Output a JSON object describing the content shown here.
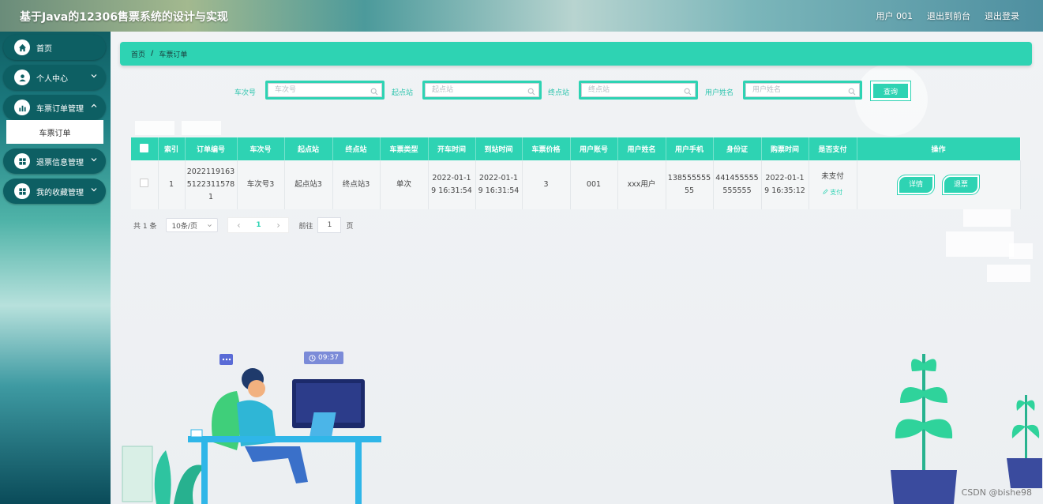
{
  "header": {
    "site_title": "基于Java的12306售票系统的设计与实现",
    "links": [
      "用户 001",
      "退出到前台",
      "退出登录"
    ]
  },
  "sidebar": {
    "items": [
      {
        "label": "首页",
        "icon": "home-icon"
      },
      {
        "label": "个人中心",
        "icon": "user-icon"
      },
      {
        "label": "车票订单管理",
        "icon": "bar-chart-icon"
      },
      {
        "label": "退票信息管理",
        "icon": "grid-icon"
      },
      {
        "label": "我的收藏管理",
        "icon": "grid-icon"
      }
    ],
    "sub_item": "车票订单"
  },
  "breadcrumb": {
    "home": "首页",
    "separator": "/",
    "current": "车票订单"
  },
  "search": {
    "train_label": "车次号",
    "train_placeholder": "车次号",
    "from_label": "起点站",
    "from_placeholder": "起点站",
    "to_label": "终点站",
    "to_placeholder": "终点站",
    "name_label": "用户姓名",
    "name_placeholder": "用户姓名",
    "query_button": "查询"
  },
  "table": {
    "columns": [
      "索引",
      "订单编号",
      "车次号",
      "起点站",
      "终点站",
      "车票类型",
      "开车时间",
      "到站时间",
      "车票价格",
      "用户账号",
      "用户姓名",
      "用户手机",
      "身份证",
      "购票时间",
      "是否支付",
      "操作"
    ],
    "rows": [
      {
        "index": "1",
        "order_no": "202211916351223115781",
        "train_no": "车次号3",
        "from": "起点站3",
        "to": "终点站3",
        "ticket_type": "单次",
        "depart_time": "2022-01-19 16:31:54",
        "arrive_time": "2022-01-19 16:31:54",
        "price": "3",
        "account": "001",
        "user_name": "xxx用户",
        "phone": "13855555555",
        "id_card": "441455555555555",
        "buy_time": "2022-01-19 16:35:12",
        "paid_status": "未支付",
        "pay_link": "支付",
        "detail_button": "详情",
        "refund_button": "退票"
      }
    ]
  },
  "pagination": {
    "total": "共 1 条",
    "page_size": "10条/页",
    "current_page": "1",
    "goto_label": "前往",
    "goto_value": "1",
    "page_suffix": "页"
  },
  "illustration": {
    "time_badge": "09:37"
  },
  "watermark": "CSDN @bishe98",
  "colors": {
    "accent": "#2ed3b3",
    "sidebar_btn": "#0d5f63"
  }
}
